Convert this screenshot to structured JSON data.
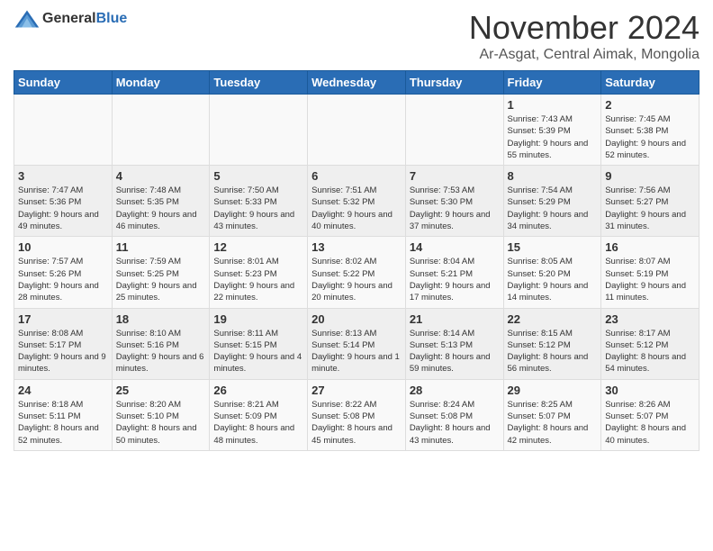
{
  "logo": {
    "general": "General",
    "blue": "Blue"
  },
  "header": {
    "month_title": "November 2024",
    "subtitle": "Ar-Asgat, Central Aimak, Mongolia"
  },
  "columns": [
    "Sunday",
    "Monday",
    "Tuesday",
    "Wednesday",
    "Thursday",
    "Friday",
    "Saturday"
  ],
  "weeks": [
    [
      {
        "day": "",
        "info": ""
      },
      {
        "day": "",
        "info": ""
      },
      {
        "day": "",
        "info": ""
      },
      {
        "day": "",
        "info": ""
      },
      {
        "day": "",
        "info": ""
      },
      {
        "day": "1",
        "info": "Sunrise: 7:43 AM\nSunset: 5:39 PM\nDaylight: 9 hours and 55 minutes."
      },
      {
        "day": "2",
        "info": "Sunrise: 7:45 AM\nSunset: 5:38 PM\nDaylight: 9 hours and 52 minutes."
      }
    ],
    [
      {
        "day": "3",
        "info": "Sunrise: 7:47 AM\nSunset: 5:36 PM\nDaylight: 9 hours and 49 minutes."
      },
      {
        "day": "4",
        "info": "Sunrise: 7:48 AM\nSunset: 5:35 PM\nDaylight: 9 hours and 46 minutes."
      },
      {
        "day": "5",
        "info": "Sunrise: 7:50 AM\nSunset: 5:33 PM\nDaylight: 9 hours and 43 minutes."
      },
      {
        "day": "6",
        "info": "Sunrise: 7:51 AM\nSunset: 5:32 PM\nDaylight: 9 hours and 40 minutes."
      },
      {
        "day": "7",
        "info": "Sunrise: 7:53 AM\nSunset: 5:30 PM\nDaylight: 9 hours and 37 minutes."
      },
      {
        "day": "8",
        "info": "Sunrise: 7:54 AM\nSunset: 5:29 PM\nDaylight: 9 hours and 34 minutes."
      },
      {
        "day": "9",
        "info": "Sunrise: 7:56 AM\nSunset: 5:27 PM\nDaylight: 9 hours and 31 minutes."
      }
    ],
    [
      {
        "day": "10",
        "info": "Sunrise: 7:57 AM\nSunset: 5:26 PM\nDaylight: 9 hours and 28 minutes."
      },
      {
        "day": "11",
        "info": "Sunrise: 7:59 AM\nSunset: 5:25 PM\nDaylight: 9 hours and 25 minutes."
      },
      {
        "day": "12",
        "info": "Sunrise: 8:01 AM\nSunset: 5:23 PM\nDaylight: 9 hours and 22 minutes."
      },
      {
        "day": "13",
        "info": "Sunrise: 8:02 AM\nSunset: 5:22 PM\nDaylight: 9 hours and 20 minutes."
      },
      {
        "day": "14",
        "info": "Sunrise: 8:04 AM\nSunset: 5:21 PM\nDaylight: 9 hours and 17 minutes."
      },
      {
        "day": "15",
        "info": "Sunrise: 8:05 AM\nSunset: 5:20 PM\nDaylight: 9 hours and 14 minutes."
      },
      {
        "day": "16",
        "info": "Sunrise: 8:07 AM\nSunset: 5:19 PM\nDaylight: 9 hours and 11 minutes."
      }
    ],
    [
      {
        "day": "17",
        "info": "Sunrise: 8:08 AM\nSunset: 5:17 PM\nDaylight: 9 hours and 9 minutes."
      },
      {
        "day": "18",
        "info": "Sunrise: 8:10 AM\nSunset: 5:16 PM\nDaylight: 9 hours and 6 minutes."
      },
      {
        "day": "19",
        "info": "Sunrise: 8:11 AM\nSunset: 5:15 PM\nDaylight: 9 hours and 4 minutes."
      },
      {
        "day": "20",
        "info": "Sunrise: 8:13 AM\nSunset: 5:14 PM\nDaylight: 9 hours and 1 minute."
      },
      {
        "day": "21",
        "info": "Sunrise: 8:14 AM\nSunset: 5:13 PM\nDaylight: 8 hours and 59 minutes."
      },
      {
        "day": "22",
        "info": "Sunrise: 8:15 AM\nSunset: 5:12 PM\nDaylight: 8 hours and 56 minutes."
      },
      {
        "day": "23",
        "info": "Sunrise: 8:17 AM\nSunset: 5:12 PM\nDaylight: 8 hours and 54 minutes."
      }
    ],
    [
      {
        "day": "24",
        "info": "Sunrise: 8:18 AM\nSunset: 5:11 PM\nDaylight: 8 hours and 52 minutes."
      },
      {
        "day": "25",
        "info": "Sunrise: 8:20 AM\nSunset: 5:10 PM\nDaylight: 8 hours and 50 minutes."
      },
      {
        "day": "26",
        "info": "Sunrise: 8:21 AM\nSunset: 5:09 PM\nDaylight: 8 hours and 48 minutes."
      },
      {
        "day": "27",
        "info": "Sunrise: 8:22 AM\nSunset: 5:08 PM\nDaylight: 8 hours and 45 minutes."
      },
      {
        "day": "28",
        "info": "Sunrise: 8:24 AM\nSunset: 5:08 PM\nDaylight: 8 hours and 43 minutes."
      },
      {
        "day": "29",
        "info": "Sunrise: 8:25 AM\nSunset: 5:07 PM\nDaylight: 8 hours and 42 minutes."
      },
      {
        "day": "30",
        "info": "Sunrise: 8:26 AM\nSunset: 5:07 PM\nDaylight: 8 hours and 40 minutes."
      }
    ]
  ]
}
